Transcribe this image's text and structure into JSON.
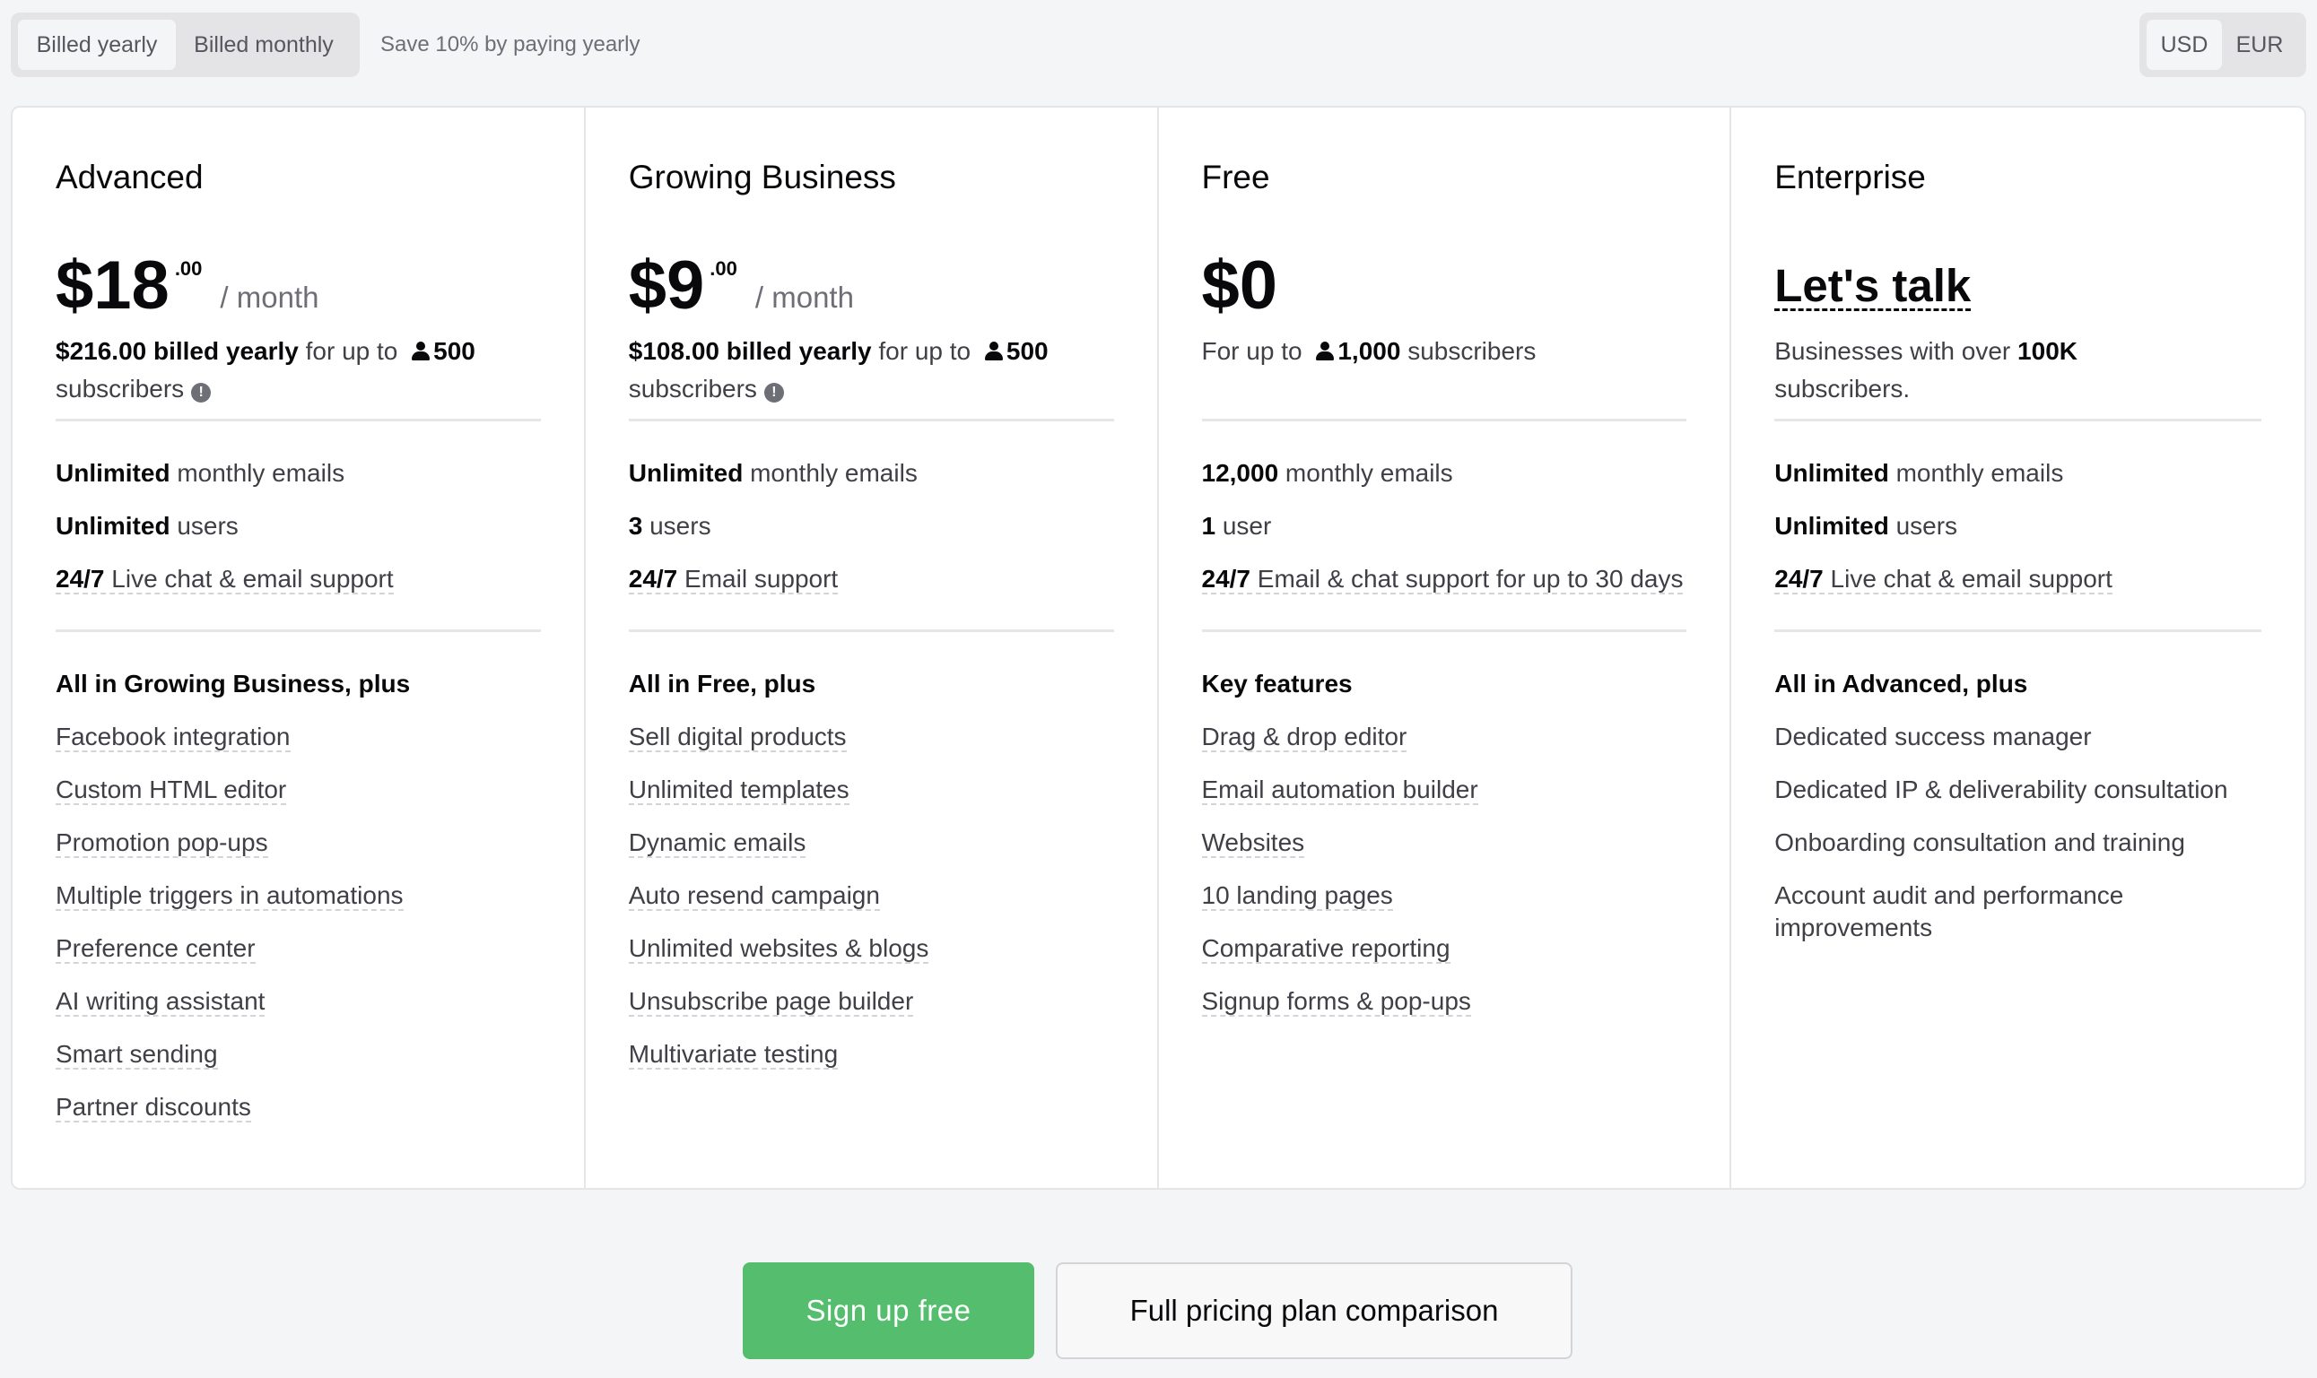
{
  "billing": {
    "yearly_label": "Billed yearly",
    "monthly_label": "Billed monthly",
    "save_note": "Save 10% by paying yearly"
  },
  "currency": {
    "usd": "USD",
    "eur": "EUR"
  },
  "plans": [
    {
      "name": "Advanced",
      "price": "$18",
      "cents": ".00",
      "period": "/ month",
      "desc_strong": "$216.00 billed yearly",
      "desc_mid": " for up to ",
      "desc_count": "500",
      "desc_end": "subscribers",
      "features": [
        {
          "strong": "Unlimited",
          "text": " monthly emails"
        },
        {
          "strong": "Unlimited",
          "text": " users"
        },
        {
          "strong": "24/7",
          "text": " Live chat & email support"
        }
      ],
      "extras_title": "All in Growing Business, plus",
      "extras": [
        "Facebook integration",
        "Custom HTML editor",
        "Promotion pop-ups",
        "Multiple triggers in automations",
        "Preference center",
        "AI writing assistant",
        "Smart sending",
        "Partner discounts"
      ]
    },
    {
      "name": "Growing Business",
      "price": "$9",
      "cents": ".00",
      "period": "/ month",
      "desc_strong": "$108.00 billed yearly",
      "desc_mid": " for up to ",
      "desc_count": "500",
      "desc_end": "subscribers",
      "features": [
        {
          "strong": "Unlimited",
          "text": " monthly emails"
        },
        {
          "strong": "3",
          "text": " users"
        },
        {
          "strong": "24/7",
          "text": " Email support"
        }
      ],
      "extras_title": "All in Free, plus",
      "extras": [
        "Sell digital products",
        "Unlimited templates",
        "Dynamic emails",
        "Auto resend campaign",
        "Unlimited websites & blogs",
        "Unsubscribe page builder",
        "Multivariate testing"
      ]
    },
    {
      "name": "Free",
      "price": "$0",
      "desc_prefix": "For up to ",
      "desc_count": "1,000",
      "desc_end": " subscribers",
      "features": [
        {
          "strong": "12,000",
          "text": " monthly emails"
        },
        {
          "strong": "1",
          "text": " user"
        },
        {
          "strong": "24/7",
          "text": " Email & chat support for up to 30 days"
        }
      ],
      "extras_title": "Key features",
      "extras": [
        "Drag & drop editor",
        "Email automation builder",
        "Websites",
        "10 landing pages",
        "Comparative reporting",
        "Signup forms & pop-ups"
      ]
    },
    {
      "name": "Enterprise",
      "price_text": "Let's talk",
      "desc_prefix": "Businesses with over ",
      "desc_strong": "100K",
      "desc_end": "subscribers.",
      "features": [
        {
          "strong": "Unlimited",
          "text": " monthly emails"
        },
        {
          "strong": "Unlimited",
          "text": " users"
        },
        {
          "strong": "24/7",
          "text": " Live chat & email support"
        }
      ],
      "extras_title": "All in Advanced, plus",
      "extras": [
        "Dedicated success manager",
        "Dedicated IP & deliverability consultation",
        "Onboarding consultation and training",
        "Account audit and performance improvements"
      ]
    }
  ],
  "cta": {
    "primary": "Sign up free",
    "secondary": "Full pricing plan comparison"
  },
  "colors": {
    "accent_green": "#55bd6e",
    "background": "#f4f5f6"
  }
}
